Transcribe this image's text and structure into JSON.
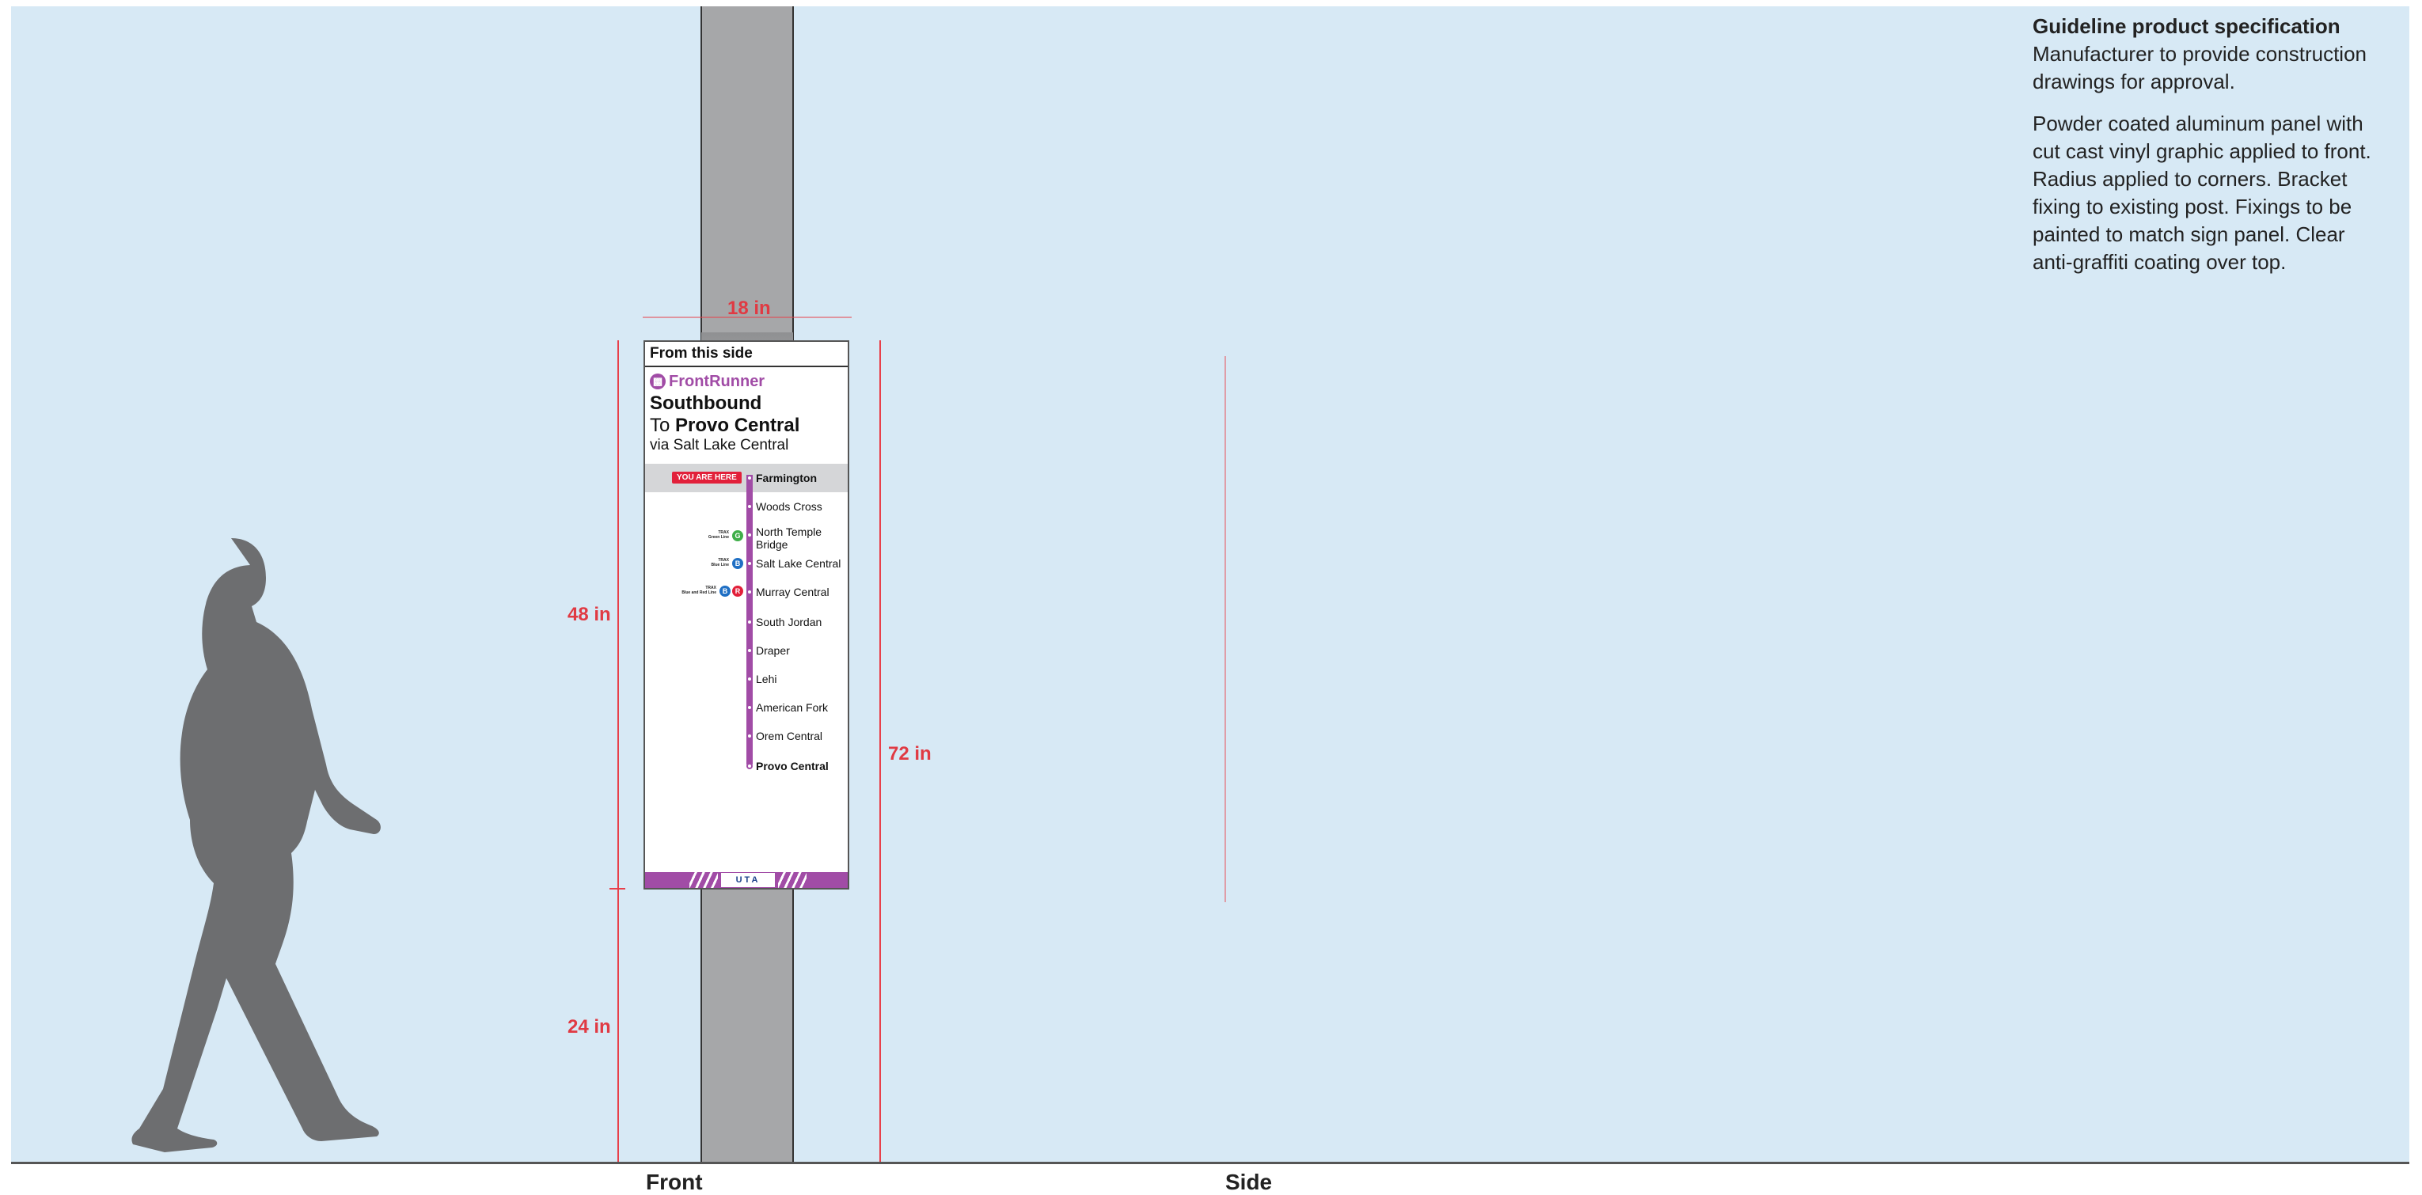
{
  "spec": {
    "title": "Guideline product specification",
    "line1": "Manufacturer to provide construction drawings for approval.",
    "line2": "Powder coated aluminum panel with cut cast vinyl graphic applied to front. Radius applied to corners. Bracket fixing to existing post. Fixings to be painted to match sign panel. Clear anti-graffiti coating over top."
  },
  "dimensions": {
    "width": "18 in",
    "panel_height": "48 in",
    "total_height": "72 in",
    "base_height": "24 in"
  },
  "views": {
    "front": "Front",
    "side": "Side"
  },
  "sign": {
    "from": "From this side",
    "brand": "FrontRunner",
    "direction": "Southbound",
    "to_prefix": "To",
    "to_station": "Provo Central",
    "via": "via Salt Lake Central",
    "here_badge": "YOU ARE HERE",
    "footer_logo": "UTA",
    "stations": [
      {
        "name": "Farmington",
        "bold": true
      },
      {
        "name": "Woods Cross",
        "bold": false
      },
      {
        "name": "North Temple",
        "name2": "Bridge",
        "bold": false
      },
      {
        "name": "Salt Lake Central",
        "bold": false
      },
      {
        "name": "Murray Central",
        "bold": false
      },
      {
        "name": "South Jordan",
        "bold": false
      },
      {
        "name": "Draper",
        "bold": false
      },
      {
        "name": "Lehi",
        "bold": false
      },
      {
        "name": "American Fork",
        "bold": false
      },
      {
        "name": "Orem Central",
        "bold": false
      },
      {
        "name": "Provo Central",
        "bold": true
      }
    ],
    "connections": {
      "green": {
        "label1": "TRAX",
        "label2": "Green Line",
        "color": "#3fae49"
      },
      "blue": {
        "label1": "TRAX",
        "label2": "Blue Line",
        "color": "#1f6fc4"
      },
      "bluered": {
        "label1": "TRAX",
        "label2": "Blue and Red Line",
        "color_a": "#1f6fc4",
        "color_b": "#e2203a"
      }
    }
  },
  "colors": {
    "accent": "#a14ca6",
    "dimension": "#e03a43",
    "background": "#d7e9f5"
  }
}
